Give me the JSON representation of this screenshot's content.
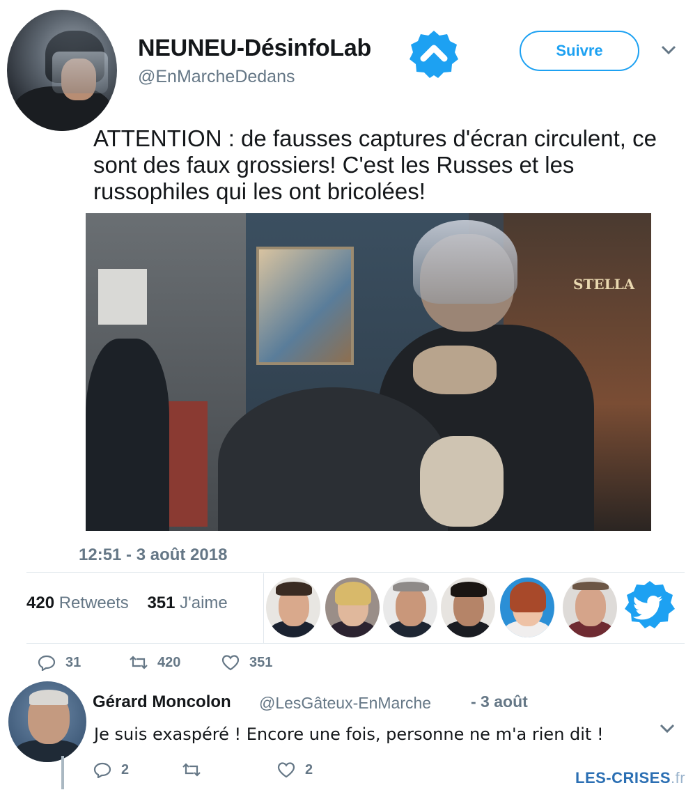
{
  "account": {
    "display_name": "NEUNEU-DésinfoLab",
    "handle": "@EnMarcheDedans",
    "follow_label": "Suivre"
  },
  "tweet": {
    "text": "ATTENTION : de fausses captures d'écran circulent, ce sont des faux grossiers! C'est les Russes et les russophiles qui les ont bricolées!",
    "image_sign": "STELLA",
    "timestamp": "12:51 - 3 août 2018",
    "retweets_count": "420",
    "retweets_label": "Retweets",
    "likes_count": "351",
    "likes_label": "J'aime",
    "reply_count": "31",
    "retweet_action_count": "420",
    "like_action_count": "351"
  },
  "reply": {
    "name": "Gérard Moncolon",
    "handle": "@LesGâteux-EnMarche",
    "time": "- 3 août",
    "text": "Je suis exaspéré ! Encore une fois, personne ne m'a rien dit !",
    "reply_count": "2",
    "retweet_count": "",
    "like_count": "2"
  },
  "watermark": {
    "main": "LES-CRISES",
    "suffix": ".fr"
  },
  "colors": {
    "twitter_blue": "#1da1f2",
    "gray_text": "#657786",
    "dark_text": "#14171a",
    "divider": "#e1e8ed"
  },
  "icons": [
    "verified-badge-icon",
    "caret-down-icon",
    "reply-icon",
    "retweet-icon",
    "like-icon",
    "twitter-bird-icon"
  ]
}
